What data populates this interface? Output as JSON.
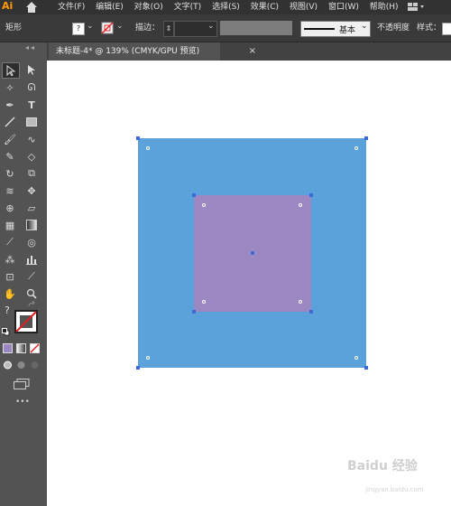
{
  "app": {
    "logo": "Ai"
  },
  "menu": [
    "文件(F)",
    "编辑(E)",
    "对象(O)",
    "文字(T)",
    "选择(S)",
    "效果(C)",
    "视图(V)",
    "窗口(W)",
    "帮助(H)"
  ],
  "control_bar": {
    "object_type": "矩形",
    "fill_value": "?",
    "stroke_label": "描边：",
    "stroke_style_label": "基本",
    "opacity_label": "不透明度",
    "style_label": "样式："
  },
  "document_tab": {
    "title": "未标题-4* @ 139% (CMYK/GPU 预览)",
    "close": "×"
  },
  "toolbar": {
    "fill_question": "?",
    "more": "•••"
  },
  "colors": {
    "outer_square": "#5aa2d9",
    "inner_square": "#9b87c1",
    "selection": "#3b6bd9",
    "canvas": "#ffffff",
    "ui_dark": "#535353"
  },
  "watermark": {
    "text": "Baidu 经验",
    "sub": "jingyan.baidu.com"
  }
}
